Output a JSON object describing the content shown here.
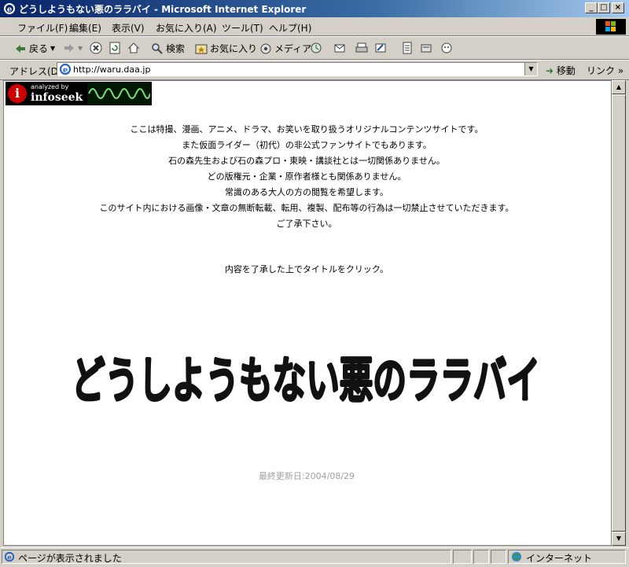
{
  "window": {
    "title": "どうしようもない悪のララバイ - Microsoft Internet Explorer",
    "controls": {
      "minimize": "_",
      "maximize": "□",
      "close": "×"
    }
  },
  "menubar": {
    "items": [
      "ファイル(F)",
      "編集(E)",
      "表示(V)",
      "お気に入り(A)",
      "ツール(T)",
      "ヘルプ(H)"
    ]
  },
  "toolbar": {
    "back_label": "戻る",
    "search_label": "検索",
    "favorites_label": "お気に入り",
    "media_label": "メディア",
    "icons": [
      "back-icon",
      "forward-icon",
      "stop-icon",
      "refresh-icon",
      "home-icon",
      "search-icon",
      "favorites-icon",
      "media-icon",
      "history-icon",
      "mail-icon",
      "print-icon",
      "edit-icon",
      "discuss-icon",
      "messenger-icon"
    ]
  },
  "addressbar": {
    "label": "アドレス(D)",
    "url": "http://waru.daa.jp",
    "go_label": "移動",
    "links_label": "リンク »"
  },
  "banner": {
    "small_text": "analyzed by",
    "brand_text": "infoseek"
  },
  "content": {
    "intro_lines": [
      "ここは特撮、漫画、アニメ、ドラマ、お笑いを取り扱うオリジナルコンテンツサイトです。",
      "また仮面ライダー（初代）の非公式ファンサイトでもあります。",
      "石の森先生および石の森プロ・東映・講談社とは一切関係ありません。",
      "どの版権元・企業・原作者様とも関係ありません。",
      "常識のある大人の方の閲覧を希望します。",
      "このサイト内における画像・文章の無断転載、転用、複製、配布等の行為は一切禁止させていただきます。",
      "ご了承下さい。"
    ],
    "instruction": "内容を了承した上でタイトルをクリック。",
    "logo_text": "どうしようもない悪のララバイ",
    "last_updated": "最終更新日:2004/08/29"
  },
  "statusbar": {
    "message": "ページが表示されました",
    "zone": "インターネット"
  },
  "colors": {
    "titlebar_start": "#0a246a",
    "titlebar_end": "#a6caf0",
    "chrome": "#d4d0c8",
    "updated_text": "#a0a0a0",
    "banner_red": "#cc0000",
    "wave_green": "#7fe07f"
  }
}
